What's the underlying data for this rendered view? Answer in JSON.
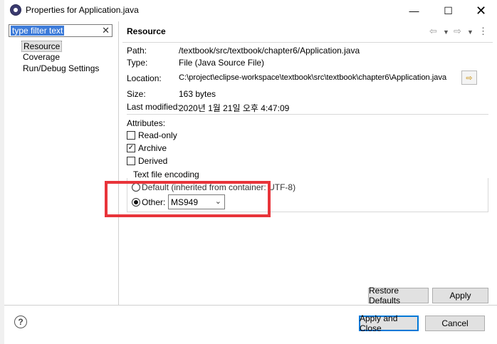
{
  "window": {
    "title": "Properties for Application.java",
    "minimize_icon": "minimize-icon",
    "maximize_icon": "maximize-icon",
    "close_icon": "close-icon"
  },
  "sidebar": {
    "filter": {
      "value": "type filter text",
      "clear_icon": "clear-icon"
    },
    "items": [
      {
        "label": "Resource",
        "selected": true
      },
      {
        "label": "Coverage",
        "selected": false
      },
      {
        "label": "Run/Debug Settings",
        "selected": false
      }
    ]
  },
  "page": {
    "title": "Resource",
    "nav_icons": [
      "back-arrow-icon",
      "dropdown-icon",
      "forward-arrow-icon",
      "dropdown-icon",
      "view-menu-icon"
    ]
  },
  "properties": {
    "path_label": "Path:",
    "path_value": "/textbook/src/textbook/chapter6/Application.java",
    "type_label": "Type:",
    "type_value": "File  (Java Source File)",
    "location_label": "Location:",
    "location_value": "C:\\project\\eclipse-workspace\\textbook\\src\\textbook\\chapter6\\Application.java",
    "size_label": "Size:",
    "size_value": "163  bytes",
    "modified_label": "Last modified:",
    "modified_value": "2020년 1월 21일 오후 4:47:09"
  },
  "attributes": {
    "label": "Attributes:",
    "read_only": {
      "label": "Read-only",
      "checked": false
    },
    "archive": {
      "label": "Archive",
      "checked": true
    },
    "derived": {
      "label": "Derived",
      "checked": false
    }
  },
  "encoding": {
    "group_label": "Text file encoding",
    "default_label": "Default (inherited from container: UTF-8)",
    "other_label": "Other:",
    "selected_option": "other",
    "other_value": "MS949"
  },
  "buttons": {
    "restore_defaults": "Restore Defaults",
    "apply": "Apply",
    "apply_and_close": "Apply and Close",
    "cancel": "Cancel",
    "help_icon": "help-icon"
  },
  "colors": {
    "highlight": "#e8343a",
    "selection": "#3d7bd9",
    "default_button_border": "#0078d7"
  }
}
